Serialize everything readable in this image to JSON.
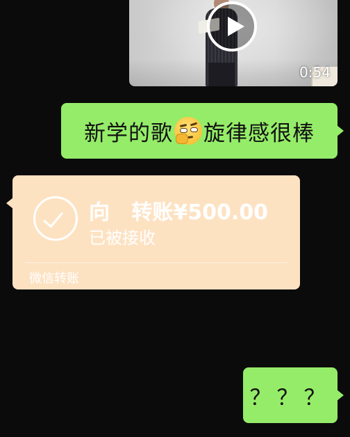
{
  "messages": {
    "video": {
      "duration": "0:54"
    },
    "text1": {
      "before_emoji": "新学的歌",
      "emoji": "thinking-face-emoji",
      "after_emoji": "旋律感很棒"
    },
    "transfer": {
      "amount_line": "向   转账¥500.00",
      "status": "已被接收",
      "footer": "微信转账"
    },
    "text2": "？？？"
  },
  "colors": {
    "background": "#0b0b0b",
    "sent_bubble": "#95ec69",
    "transfer_card": "#fde2c2"
  }
}
